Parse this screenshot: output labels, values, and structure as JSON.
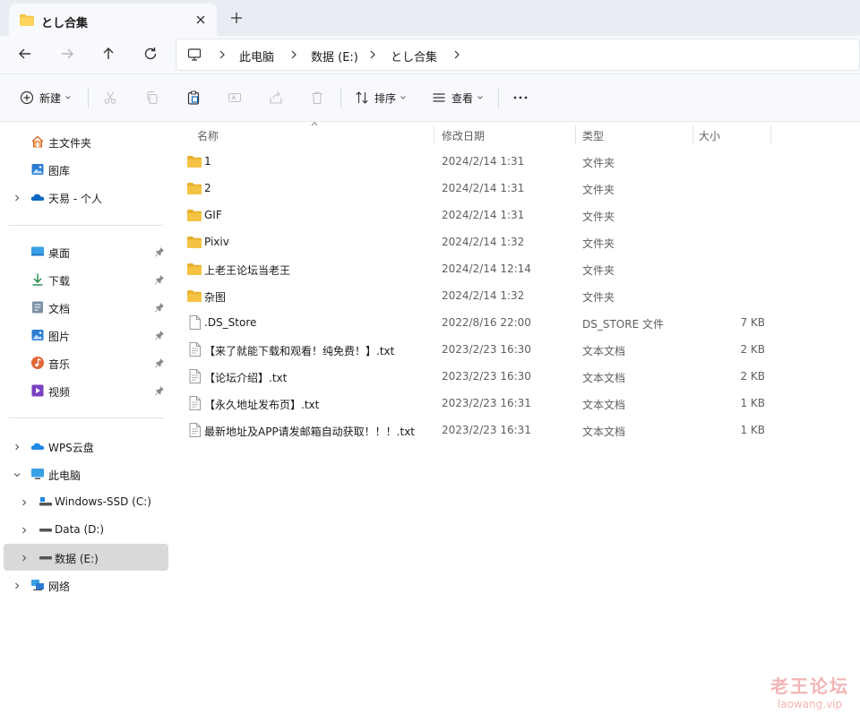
{
  "tab": {
    "title": "とし合集"
  },
  "breadcrumb": [
    "此电脑",
    "数据 (E:)",
    "とし合集"
  ],
  "toolbar": {
    "new_label": "新建",
    "sort_label": "排序",
    "view_label": "查看"
  },
  "sidebar": {
    "quick": [
      {
        "label": "主文件夹",
        "icon": "home-icon"
      },
      {
        "label": "图库",
        "icon": "gallery-icon"
      },
      {
        "label": "天易 - 个人",
        "icon": "onedrive-icon"
      }
    ],
    "pinned": [
      {
        "label": "桌面",
        "icon": "desktop-icon"
      },
      {
        "label": "下载",
        "icon": "download-icon"
      },
      {
        "label": "文档",
        "icon": "documents-icon"
      },
      {
        "label": "图片",
        "icon": "pictures-icon"
      },
      {
        "label": "音乐",
        "icon": "music-icon"
      },
      {
        "label": "视频",
        "icon": "videos-icon"
      }
    ],
    "tree": [
      {
        "label": "WPS云盘",
        "icon": "cloud-icon"
      },
      {
        "label": "此电脑",
        "icon": "this-pc-icon"
      },
      {
        "label": "Windows-SSD (C:)",
        "icon": "drive-c-icon"
      },
      {
        "label": "Data (D:)",
        "icon": "drive-icon"
      },
      {
        "label": "数据 (E:)",
        "icon": "drive-icon"
      },
      {
        "label": "网络",
        "icon": "network-icon"
      }
    ]
  },
  "columns": {
    "name": "名称",
    "date": "修改日期",
    "type": "类型",
    "size": "大小"
  },
  "files": [
    {
      "name": "1",
      "date": "2024/2/14 1:31",
      "type": "文件夹",
      "size": "",
      "kind": "folder"
    },
    {
      "name": "2",
      "date": "2024/2/14 1:31",
      "type": "文件夹",
      "size": "",
      "kind": "folder"
    },
    {
      "name": "GIF",
      "date": "2024/2/14 1:31",
      "type": "文件夹",
      "size": "",
      "kind": "folder"
    },
    {
      "name": "Pixiv",
      "date": "2024/2/14 1:32",
      "type": "文件夹",
      "size": "",
      "kind": "folder"
    },
    {
      "name": "上老王论坛当老王",
      "date": "2024/2/14 12:14",
      "type": "文件夹",
      "size": "",
      "kind": "folder"
    },
    {
      "name": "杂图",
      "date": "2024/2/14 1:32",
      "type": "文件夹",
      "size": "",
      "kind": "folder"
    },
    {
      "name": ".DS_Store",
      "date": "2022/8/16 22:00",
      "type": "DS_STORE 文件",
      "size": "7 KB",
      "kind": "file"
    },
    {
      "name": "【来了就能下载和观看！纯免费！】.txt",
      "date": "2023/2/23 16:30",
      "type": "文本文档",
      "size": "2 KB",
      "kind": "text"
    },
    {
      "name": "【论坛介绍】.txt",
      "date": "2023/2/23 16:30",
      "type": "文本文档",
      "size": "2 KB",
      "kind": "text"
    },
    {
      "name": "【永久地址发布页】.txt",
      "date": "2023/2/23 16:31",
      "type": "文本文档",
      "size": "1 KB",
      "kind": "text"
    },
    {
      "name": "最新地址及APP请发邮箱自动获取！！！.txt",
      "date": "2023/2/23 16:31",
      "type": "文本文档",
      "size": "1 KB",
      "kind": "text"
    }
  ],
  "watermark": {
    "title": "老王论坛",
    "url": "laowang.vip"
  },
  "colors": {
    "folder": "#f5c343",
    "selected": "#d9d9d9",
    "accent": "#0067c0"
  }
}
